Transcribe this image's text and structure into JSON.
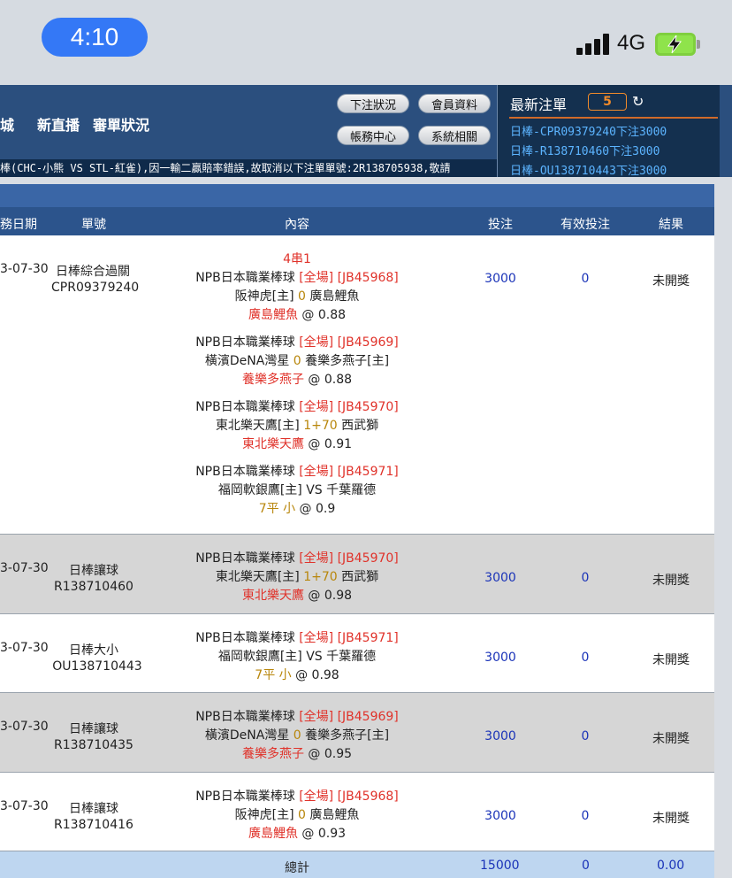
{
  "status": {
    "time": "4:10",
    "network": "4G"
  },
  "header": {
    "nav": [
      "城",
      "新直播",
      "審單狀況"
    ],
    "buttons": [
      "下注狀況",
      "會員資料",
      "帳務中心",
      "系統相關"
    ],
    "ticker": "棒(CHC-小熊 VS STL-紅雀),因一輸二贏賠率錯誤,故取消以下注單單號:2R138705938,敬請"
  },
  "latest": {
    "title": "最新注單",
    "count": "5",
    "items": [
      {
        "sport": "日棒",
        "ref": "-CPR09379240",
        "text": "下注",
        "amount": "3000"
      },
      {
        "sport": "日棒",
        "ref": "-R138710460",
        "text": "下注",
        "amount": "3000"
      },
      {
        "sport": "日棒",
        "ref": "-OU138710443",
        "text": "下注",
        "amount": "3000"
      }
    ]
  },
  "columns": [
    "務日期",
    "單號",
    "內容",
    "投注",
    "有效投注",
    "結果"
  ],
  "rows": [
    {
      "date": "3-07-30",
      "type": "日棒綜合過關",
      "id": "CPR09379240",
      "parlay": "4串1",
      "games": [
        {
          "league": "NPB日本職業棒球",
          "period": "[全場]",
          "code": "[JB45968]",
          "home": "阪神虎[主]",
          "handicap": "0",
          "away": "廣島鯉魚",
          "pick": "廣島鯉魚",
          "odds": "@ 0.88"
        },
        {
          "league": "NPB日本職業棒球",
          "period": "[全場]",
          "code": "[JB45969]",
          "home": "橫濱DeNA灣星",
          "handicap": "0",
          "away": "養樂多燕子[主]",
          "pick": "養樂多燕子",
          "odds": "@ 0.88"
        },
        {
          "league": "NPB日本職業棒球",
          "period": "[全場]",
          "code": "[JB45970]",
          "home": "東北樂天鷹[主]",
          "handicap": "1+70",
          "away": "西武獅",
          "pick": "東北樂天鷹",
          "odds": "@ 0.91"
        },
        {
          "league": "NPB日本職業棒球",
          "period": "[全場]",
          "code": "[JB45971]",
          "home": "福岡軟銀鷹[主]",
          "handicap": "VS",
          "away": "千葉羅德",
          "pick": "7平 小",
          "odds": "@ 0.9"
        }
      ],
      "stake": "3000",
      "valid": "0",
      "result": "未開獎"
    },
    {
      "date": "3-07-30",
      "type": "日棒讓球",
      "id": "R138710460",
      "games": [
        {
          "league": "NPB日本職業棒球",
          "period": "[全場]",
          "code": "[JB45970]",
          "home": "東北樂天鷹[主]",
          "handicap": "1+70",
          "away": "西武獅",
          "pick": "東北樂天鷹",
          "odds": "@ 0.98"
        }
      ],
      "stake": "3000",
      "valid": "0",
      "result": "未開獎"
    },
    {
      "date": "3-07-30",
      "type": "日棒大小",
      "id": "OU138710443",
      "games": [
        {
          "league": "NPB日本職業棒球",
          "period": "[全場]",
          "code": "[JB45971]",
          "home": "福岡軟銀鷹[主]",
          "handicap": "VS",
          "away": "千葉羅德",
          "pick": "7平 小",
          "odds": "@ 0.98"
        }
      ],
      "stake": "3000",
      "valid": "0",
      "result": "未開獎"
    },
    {
      "date": "3-07-30",
      "type": "日棒讓球",
      "id": "R138710435",
      "games": [
        {
          "league": "NPB日本職業棒球",
          "period": "[全場]",
          "code": "[JB45969]",
          "home": "橫濱DeNA灣星",
          "handicap": "0",
          "away": "養樂多燕子[主]",
          "pick": "養樂多燕子",
          "odds": "@ 0.95"
        }
      ],
      "stake": "3000",
      "valid": "0",
      "result": "未開獎"
    },
    {
      "date": "3-07-30",
      "type": "日棒讓球",
      "id": "R138710416",
      "games": [
        {
          "league": "NPB日本職業棒球",
          "period": "[全場]",
          "code": "[JB45968]",
          "home": "阪神虎[主]",
          "handicap": "0",
          "away": "廣島鯉魚",
          "pick": "廣島鯉魚",
          "odds": "@ 0.93"
        }
      ],
      "stake": "3000",
      "valid": "0",
      "result": "未開獎"
    }
  ],
  "total": {
    "label": "總計",
    "stake": "15000",
    "valid": "0",
    "result": "0.00"
  },
  "colors": {
    "header": "#2b4f7e",
    "accent_red": "#e0322a",
    "accent_gold": "#b8860b",
    "num_blue": "#1a33b8",
    "latest_blue": "#5cb4ff"
  }
}
